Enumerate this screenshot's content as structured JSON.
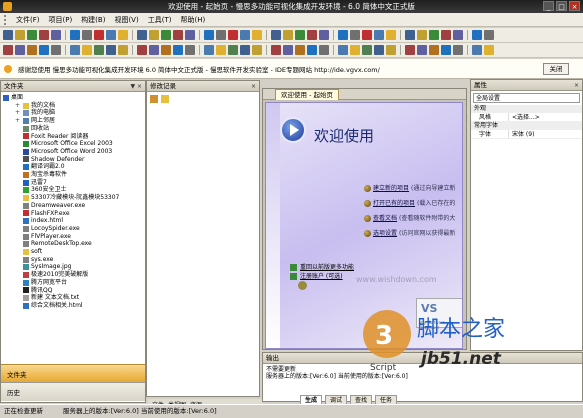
{
  "window": {
    "title": "欢迎使用 - 起始页 - 慢思多功能可视化集成开发环境 - 6.0 简体中文正式版",
    "min": "_",
    "max": "□",
    "close": "×"
  },
  "menu": [
    "文件(F)",
    "项目(P)",
    "构建(B)",
    "视图(V)",
    "工具(T)",
    "帮助(H)"
  ],
  "infobar": {
    "text": "感谢您使用 慢思多功能可视化集成开发环境 6.0 简体中文正式版 - 慢思软件开发实验室 - IDE专题网站 http://ide.vgvx.com/",
    "close": "关闭"
  },
  "left_panel": {
    "title": "文件夹",
    "pin": "▼ ×",
    "tree": [
      {
        "label": "桌面",
        "level": 0,
        "icon": "desktop-icon",
        "color": "#3060c0"
      },
      {
        "label": "我的文档",
        "level": 1,
        "icon": "folder-icon",
        "color": "#e8c040"
      },
      {
        "label": "我的电脑",
        "level": 1,
        "icon": "computer-icon",
        "color": "#7090c0"
      },
      {
        "label": "网上邻居",
        "level": 1,
        "icon": "network-icon",
        "color": "#5080b0"
      },
      {
        "label": "回收站",
        "level": 1,
        "icon": "recycle-bin-icon",
        "color": "#6a8a6a"
      },
      {
        "label": "Foxit Reader 阅读器",
        "level": 1,
        "icon": "shortcut-icon",
        "color": "#c03030"
      },
      {
        "label": "Microsoft Office Excel 2003",
        "level": 1,
        "icon": "excel-icon",
        "color": "#2a8a3a"
      },
      {
        "label": "Microsoft Office Word 2003",
        "level": 1,
        "icon": "word-icon",
        "color": "#2a4aa0"
      },
      {
        "label": "Shadow Defender",
        "level": 1,
        "icon": "shield-icon",
        "color": "#505050"
      },
      {
        "label": "翻译词霸2.0",
        "level": 1,
        "icon": "shortcut-icon",
        "color": "#2070c0"
      },
      {
        "label": "淘宝杀毒软件",
        "level": 1,
        "icon": "shortcut-icon",
        "color": "#c07020"
      },
      {
        "label": "迅雷7",
        "level": 1,
        "icon": "thunder-icon",
        "color": "#2060c0"
      },
      {
        "label": "360安全卫士",
        "level": 1,
        "icon": "shield-icon",
        "color": "#30a030"
      },
      {
        "label": "53307冷藏模块-阮鑫模块53307",
        "level": 1,
        "icon": "folder-icon",
        "color": "#e8c040"
      },
      {
        "label": "Dreamweaver.exe",
        "level": 1,
        "icon": "file-icon",
        "color": "#808080"
      },
      {
        "label": "FlashFXP.exe",
        "level": 1,
        "icon": "file-icon",
        "color": "#c03030"
      },
      {
        "label": "index.html",
        "level": 1,
        "icon": "html-icon",
        "color": "#3070c0"
      },
      {
        "label": "LocoySpider.exe",
        "level": 1,
        "icon": "file-icon",
        "color": "#808080"
      },
      {
        "label": "FlVPlayer.exe",
        "level": 1,
        "icon": "file-icon",
        "color": "#808080"
      },
      {
        "label": "RemoteDeskTop.exe",
        "level": 1,
        "icon": "file-icon",
        "color": "#808080"
      },
      {
        "label": "soft",
        "level": 1,
        "icon": "folder-icon",
        "color": "#e8c040"
      },
      {
        "label": "sys.exe",
        "level": 1,
        "icon": "file-icon",
        "color": "#808080"
      },
      {
        "label": "SysImage.jpg",
        "level": 1,
        "icon": "image-icon",
        "color": "#4090a0"
      },
      {
        "label": "极速2010完美破解版",
        "level": 1,
        "icon": "shortcut-icon",
        "color": "#c04040"
      },
      {
        "label": "腾方网宽平台",
        "level": 1,
        "icon": "shortcut-icon",
        "color": "#3080c0"
      },
      {
        "label": "腾讯QQ",
        "level": 1,
        "icon": "qq-icon",
        "color": "#202020"
      },
      {
        "label": "新建 文本文档.txt",
        "level": 1,
        "icon": "text-file-icon",
        "color": "#a0a0a0"
      },
      {
        "label": "综合文档相关.html",
        "level": 1,
        "icon": "html-icon",
        "color": "#3070c0"
      }
    ],
    "tab_folder": "文件夹",
    "tab_history": "历史"
  },
  "mid_panel": {
    "title": "修改记录",
    "pin": "×"
  },
  "center": {
    "tab": "欢迎使用 - 起始页",
    "welcome": "欢迎使用",
    "links": [
      {
        "link": "建立新的项目",
        "desc": "(通过向导建立新"
      },
      {
        "link": "打开已有的项目",
        "desc": "(载入已存在的"
      },
      {
        "link": "查看文档",
        "desc": "(查看随软件附带的大"
      },
      {
        "link": "选项设置",
        "desc": "(访问官网以获得最新"
      }
    ],
    "links2": [
      {
        "text": "重回以前版更多功能"
      },
      {
        "text": "注册账户 (可选)"
      }
    ],
    "logo_text": "VS",
    "logo_sub": "Voy Software Developer",
    "site": "www.wishdown.com"
  },
  "right_panel": {
    "title": "属性",
    "dropdown": "全局设置",
    "section1": "外观",
    "rows": [
      {
        "k": "风格",
        "v": "<选择...>"
      }
    ],
    "section2": "常用字体",
    "rows2": [
      {
        "k": "字体",
        "v": "宋体 (9)"
      }
    ]
  },
  "output": {
    "title": "输出",
    "lines": [
      "不需要更新",
      "服务器上的版本:[Ver:6.0] 当前使用的版本:[Ver:6.0]"
    ],
    "tabs": [
      "生成",
      "调试",
      "查找",
      "任务"
    ]
  },
  "lower_left_tabs": [
    "文件",
    "类视图",
    "资源"
  ],
  "status": {
    "left": "正在检查更新",
    "right": "服务器上的版本:[Ver:6.0] 当前使用的版本:[Ver:6.0]"
  },
  "watermark": {
    "brand": "脚本之家",
    "url": "jb51.net",
    "script": "Script"
  },
  "colors": {
    "accent": "#e8a830",
    "title_bg": "#2a2a2a",
    "welcome_text": "#1a2a70"
  }
}
